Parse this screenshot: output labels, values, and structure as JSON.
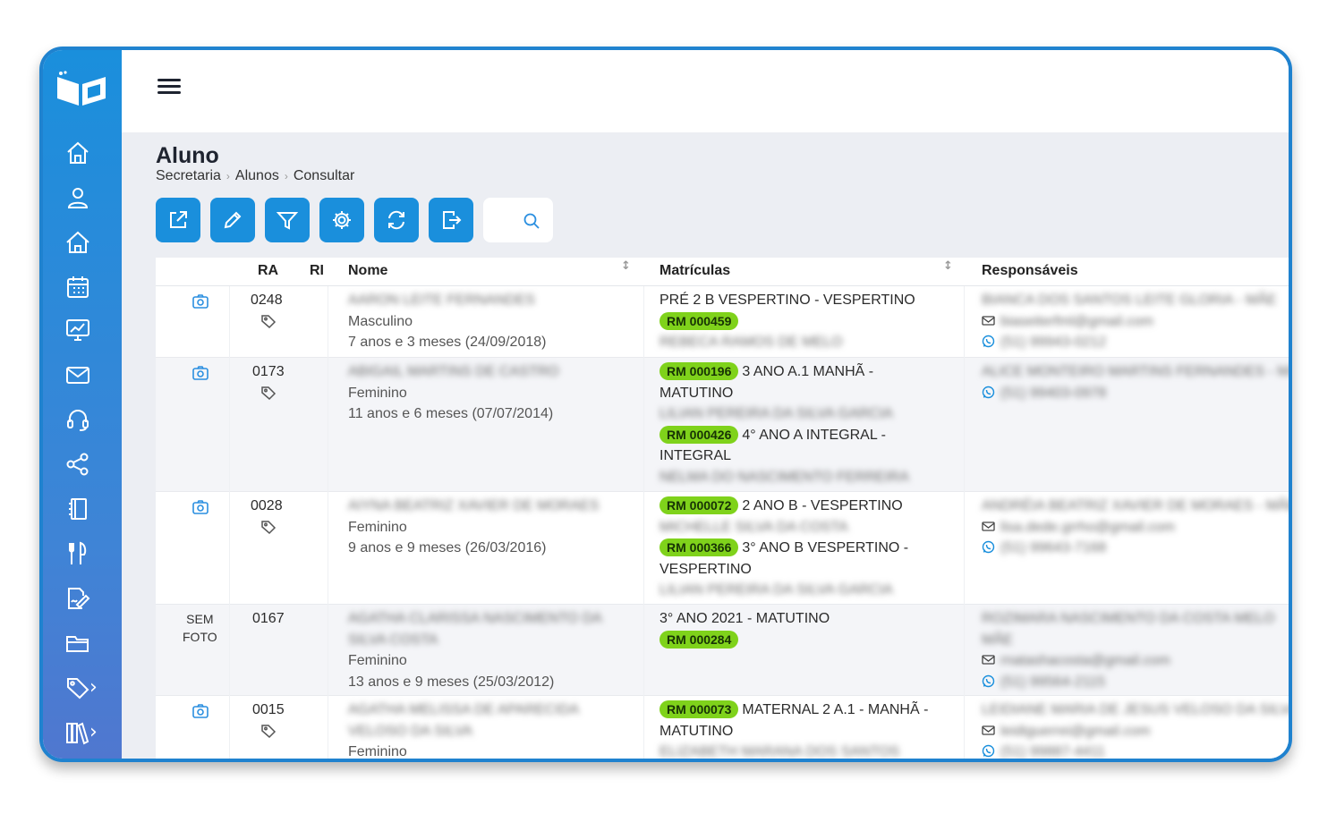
{
  "app": {
    "brand_color": "#1a8fdc",
    "badge_color": "#7fd21b"
  },
  "header": {
    "menu_icon": "hamburger-icon"
  },
  "page": {
    "title": "Aluno",
    "breadcrumb": [
      "Secretaria",
      "Alunos",
      "Consultar"
    ]
  },
  "toolbar": {
    "buttons": [
      "open-external-icon",
      "edit-pencil-icon",
      "filter-icon",
      "gear-icon",
      "refresh-icon",
      "export-icon"
    ],
    "search_icon": "search-icon"
  },
  "sidebar": {
    "items": [
      "home-icon",
      "user-icon",
      "school-home-icon",
      "calendar-icon",
      "chart-icon",
      "mail-icon",
      "headset-icon",
      "share-icon",
      "book-icon",
      "cutlery-icon",
      "signature-icon",
      "folder-icon",
      "tag-icon",
      "library-icon"
    ]
  },
  "table": {
    "columns": {
      "ra": "RA",
      "ri": "RI",
      "nome": "Nome",
      "matriculas": "Matrículas",
      "responsaveis": "Responsáveis"
    },
    "rows": [
      {
        "photo": "camera-icon",
        "ra": "0248",
        "nome": "AARON LEITE FERNANDES",
        "sexo": "Masculino",
        "idade": "7 anos e 3 meses (24/09/2018)",
        "mat1_pre": "PRÉ 2 B VESPERTINO - VESPERTINO",
        "mat1_badge": "RM 000459",
        "mat1_resp": "REBECA RAMOS DE MELO",
        "resp_name": "BIANCA DOS SANTOS LEITE GLORIA - MÃE",
        "resp_email": "biaseiterfml@gmail.com",
        "resp_phone": "(51) 99943-0212"
      },
      {
        "photo": "camera-icon",
        "ra": "0173",
        "nome": "ABIGAIL MARTINS DE CASTRO",
        "sexo": "Feminino",
        "idade": "11 anos e 6 meses (07/07/2014)",
        "mat1_badge": "RM 000196",
        "mat1_text": "3 ANO A.1 MANHÃ -",
        "mat1_text2": "MATUTINO",
        "mat1_resp": "LILIAN PEREIRA DA SILVA GARCIA",
        "mat2_badge": "RM 000426",
        "mat2_text": "4° ANO A INTEGRAL -",
        "mat2_text2": "INTEGRAL",
        "mat2_resp": "NELMA DO NASCIMENTO FERREIRA",
        "resp_name": "ALICE MONTEIRO MARTINS FERNANDES - MÃE",
        "resp_phone": "(51) 99403-0978"
      },
      {
        "photo": "camera-icon",
        "ra": "0028",
        "nome": "AIYNA BEATRIZ XAVIER DE MORAES",
        "sexo": "Feminino",
        "idade": "9 anos e 9 meses (26/03/2016)",
        "mat1_badge": "RM 000072",
        "mat1_text": "2 ANO B - VESPERTINO",
        "mat1_resp": "MICHELLE SILVA DA COSTA",
        "mat2_badge": "RM 000366",
        "mat2_text": "3° ANO B VESPERTINO -",
        "mat2_text2": "VESPERTINO",
        "mat2_resp": "LILIAN PEREIRA DA SILVA GARCIA",
        "resp_name": "ANDRÉIA BEATRIZ XAVIER DE MORAES - MÃE",
        "resp_email": "lisa.dede.grrho@gmail.com",
        "resp_phone": "(51) 99643-7168"
      },
      {
        "photo_text": [
          "SEM",
          "FOTO"
        ],
        "ra": "0167",
        "nome": "AGATHA CLARISSA NASCIMENTO DA",
        "nome2": "SILVA COSTA",
        "sexo": "Feminino",
        "idade": "13 anos e 9 meses (25/03/2012)",
        "mat1_pre": "3° ANO 2021 - MATUTINO",
        "mat1_badge": "RM 000284",
        "resp_name": "ROZIMARA NASCIMENTO DA COSTA MELO",
        "resp_name2": "MÃE",
        "resp_email": "rnatashacosta@gmail.com",
        "resp_phone": "(51) 99564-2115"
      },
      {
        "photo": "camera-icon",
        "ra": "0015",
        "nome": "AGATHA MELISSA DE APARECIDA",
        "nome2": "VELOSO DA SILVA",
        "sexo": "Feminino",
        "mat1_badge": "RM 000073",
        "mat1_text": "MATERNAL 2 A.1 - MANHÃ -",
        "mat1_text2": "MATUTINO",
        "mat1_resp": "ELIZABETH MARANA DOS SANTOS",
        "resp_name": "LEIDIANE MARIA DE JESUS VELOSO DA SILVA",
        "resp_email": "leidiguerrei@gmail.com",
        "resp_phone": "(51) 99887-4411"
      }
    ]
  }
}
